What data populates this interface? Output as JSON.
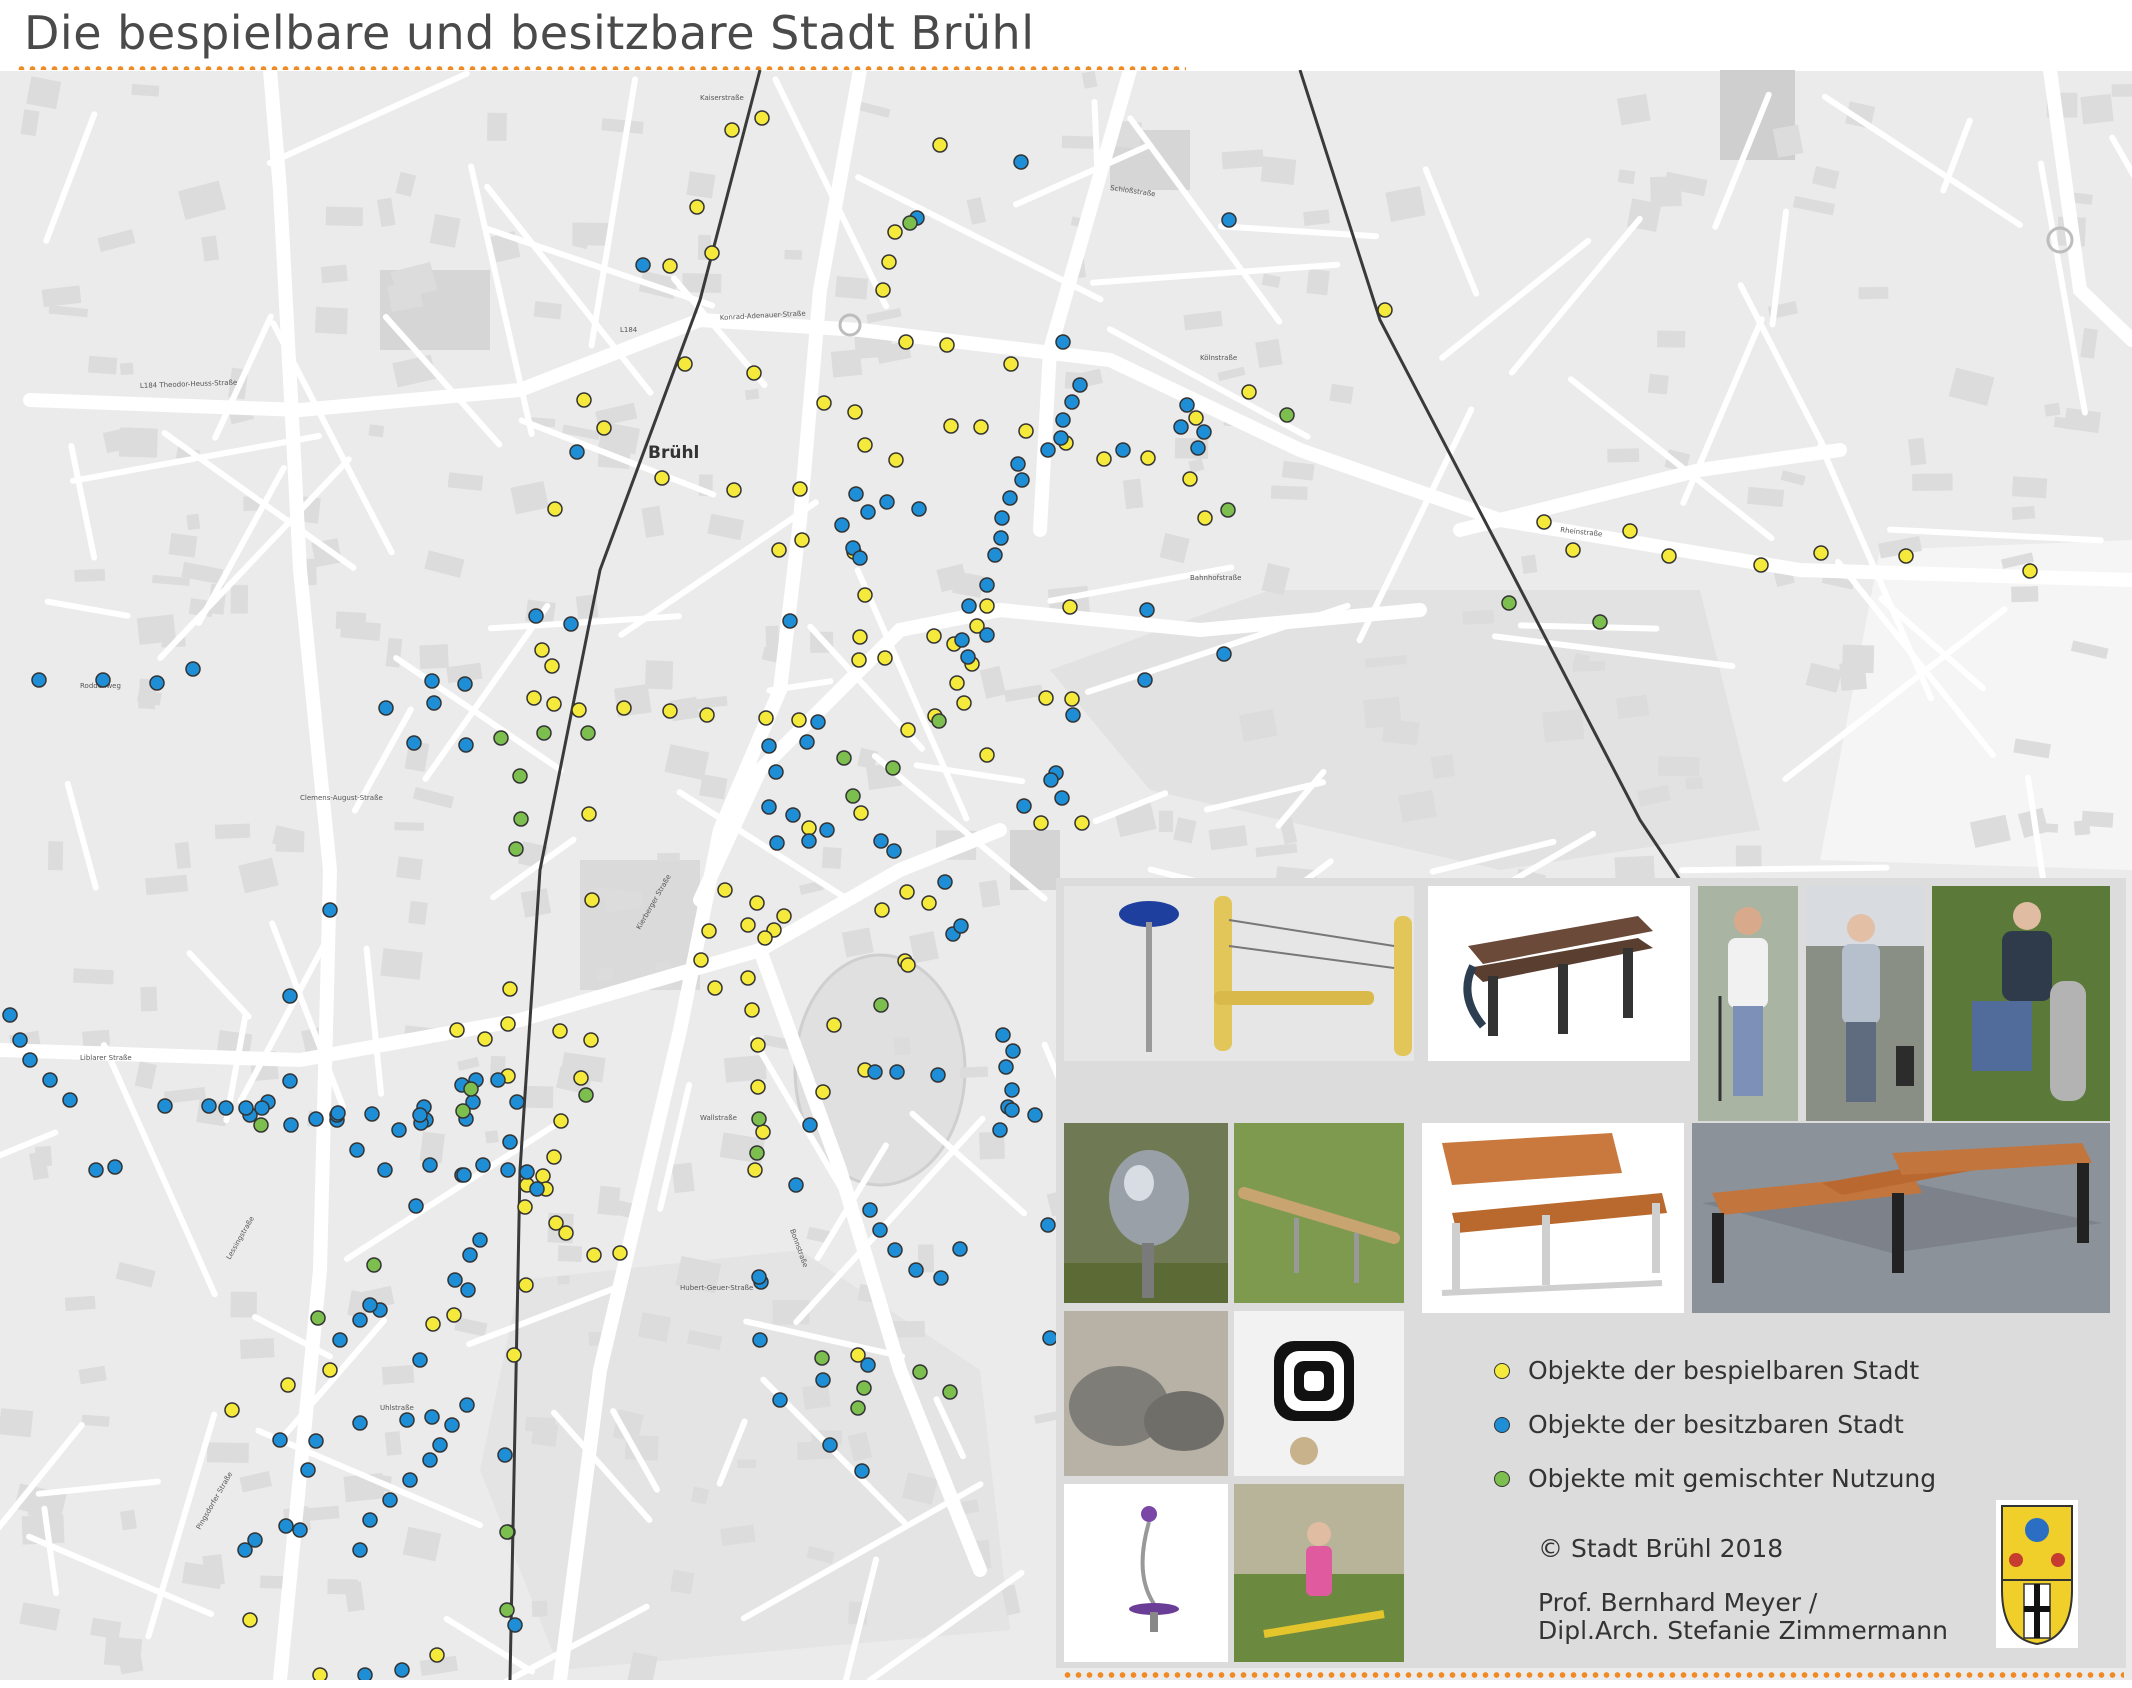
{
  "title": "Die bespielbare und besitzbare Stadt Brühl",
  "colors": {
    "accent_orange": "#f08a24",
    "yellow": "#f5ea3c",
    "blue": "#1e8fd6",
    "green": "#7cbf4f",
    "road": "#ffffff",
    "land": "#ebebeb",
    "building": "#d8d8d8",
    "panel": "#dcdcdc"
  },
  "map": {
    "place_label": "Brühl",
    "street_labels": {
      "kaiserstr": "Kaiserstraße",
      "kgadenauer": "Konrad-Adenauer-Straße",
      "l184": "L184",
      "theodor": "L184 Theodor-Heuss-Straße",
      "roddenweg": "Roddenweg",
      "liblarer": "Liblarer Straße",
      "rheinstr": "Rheinstraße",
      "bonnstr": "Bonnstraße",
      "bahnhofstr": "Bahnhofstraße",
      "schlossstr": "Schloßstraße",
      "clemensstr": "Clemens-August-Straße",
      "kölnstr": "Kölnstraße",
      "kierberger": "Kierberger Straße",
      "hubert": "Hubert-Geuer-Straße",
      "uhlstr": "Uhlstraße",
      "wallstr": "Wallstraße",
      "pingsdorfer": "Pingsdorfer Straße",
      "lessing": "Lessingstraße"
    }
  },
  "legend": {
    "items": [
      {
        "label": "Objekte der bespielbaren Stadt",
        "color": "#f5ea3c"
      },
      {
        "label": "Objekte der besitzbaren Stadt",
        "color": "#1e8fd6"
      },
      {
        "label": "Objekte mit gemischter Nutzung",
        "color": "#7cbf4f"
      }
    ],
    "copyright": "© Stadt Brühl 2018",
    "author_line1": "Prof. Bernhard Meyer /",
    "author_line2": "Dipl.Arch. Stefanie Zimmermann"
  },
  "photos": [
    "photo-spinning-top",
    "photo-balance-bar",
    "photo-double-bench",
    "photo-woman-with-cane",
    "photo-woman-standing",
    "photo-man-sitting-pole",
    "photo-metal-sphere",
    "photo-wooden-log",
    "photo-wooden-bench",
    "photo-cross-benches",
    "photo-stones",
    "photo-spiral-disk",
    "photo-wobble-stick",
    "photo-girl-seesaw",
    "city-crest"
  ]
}
